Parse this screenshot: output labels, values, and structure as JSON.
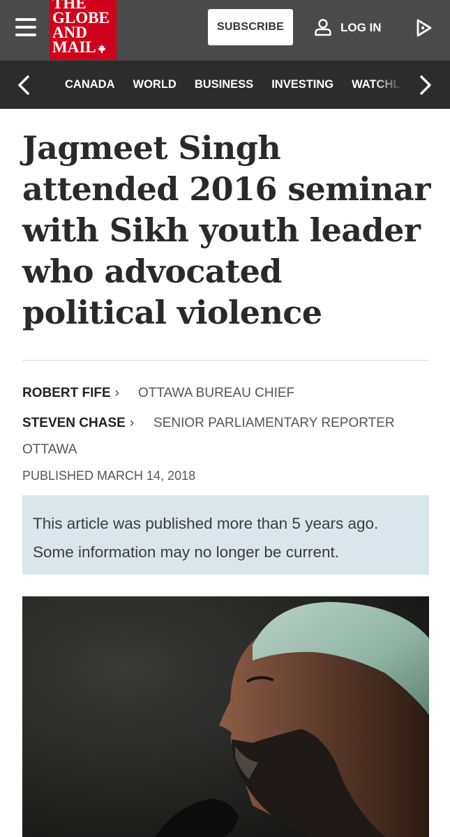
{
  "header": {
    "logo_lines": [
      "THE",
      "GLOBE",
      "AND",
      "MAIL"
    ],
    "subscribe_label": "SUBSCRIBE",
    "login_label": "LOG IN",
    "brand_color": "#d0021b"
  },
  "nav": {
    "items": [
      "CANADA",
      "WORLD",
      "BUSINESS",
      "INVESTING",
      "WATCHL"
    ]
  },
  "article": {
    "headline": "Jagmeet Singh attended 2016 seminar with Sikh youth leader who advocated political violence",
    "authors": [
      {
        "name": "ROBERT FIFE",
        "role": "OTTAWA BUREAU CHIEF"
      },
      {
        "name": "STEVEN CHASE",
        "role": "SENIOR PARLIAMENTARY REPORTER"
      }
    ],
    "dateline": "OTTAWA",
    "published": "PUBLISHED MARCH 14, 2018",
    "notice_line1": "This article was published more than 5 years ago.",
    "notice_line2": "Some information may no longer be current."
  },
  "icons": {
    "menu": "hamburger-icon",
    "account": "person-icon",
    "play": "play-icon",
    "nav_prev": "chevron-left-icon",
    "nav_next": "chevron-right-icon"
  }
}
